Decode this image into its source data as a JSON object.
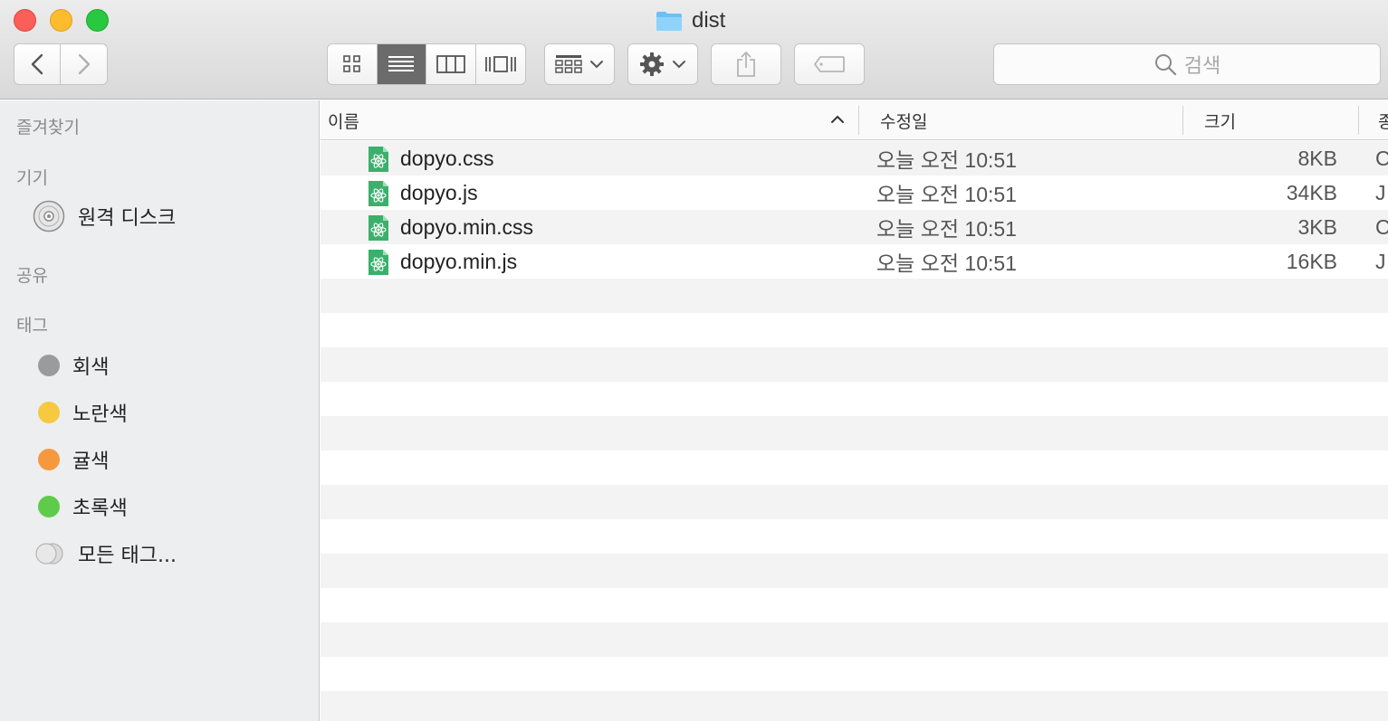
{
  "window": {
    "title": "dist"
  },
  "search": {
    "placeholder": "검색"
  },
  "sidebar": {
    "favorites_heading": "즐겨찾기",
    "devices_heading": "기기",
    "devices": [
      {
        "label": "원격 디스크"
      }
    ],
    "shared_heading": "공유",
    "tags_heading": "태그",
    "tags": [
      {
        "label": "회색",
        "color": "#9b9b9d"
      },
      {
        "label": "노란색",
        "color": "#f6c941"
      },
      {
        "label": "귤색",
        "color": "#f6993e"
      },
      {
        "label": "초록색",
        "color": "#5fcb4a"
      },
      {
        "label": "모든 태그..."
      }
    ]
  },
  "columns": {
    "name": "이름",
    "modified": "수정일",
    "size": "크기",
    "kind": "종"
  },
  "files": [
    {
      "name": "dopyo.css",
      "modified": "오늘 오전 10:51",
      "size": "8KB",
      "kind": "C"
    },
    {
      "name": "dopyo.js",
      "modified": "오늘 오전 10:51",
      "size": "34KB",
      "kind": "J"
    },
    {
      "name": "dopyo.min.css",
      "modified": "오늘 오전 10:51",
      "size": "3KB",
      "kind": "C"
    },
    {
      "name": "dopyo.min.js",
      "modified": "오늘 오전 10:51",
      "size": "16KB",
      "kind": "J"
    }
  ],
  "icons": {
    "file": "atom-file-icon",
    "folder": "folder-icon",
    "disk": "disk-icon"
  }
}
